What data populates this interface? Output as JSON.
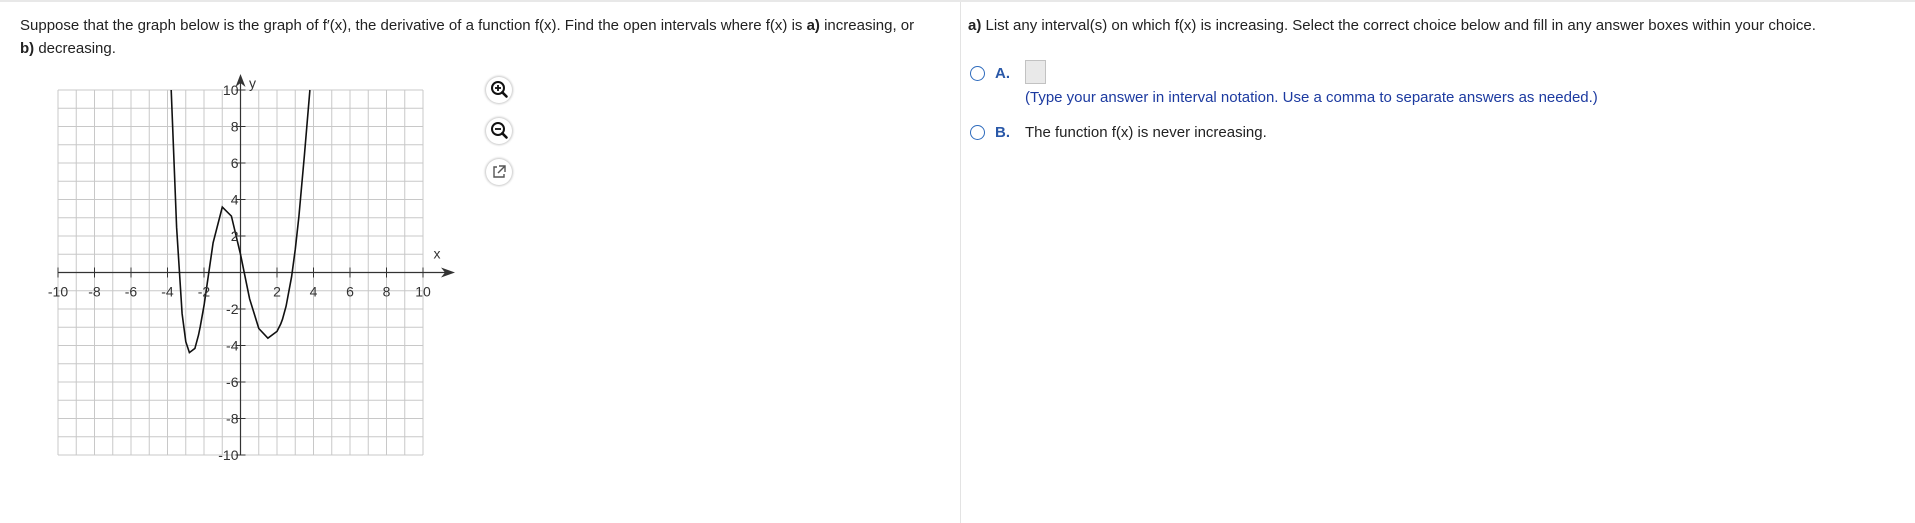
{
  "question": {
    "text_1": "Suppose that the graph below is the graph of ",
    "fprime": "f′(x)",
    "text_2": ", the derivative of a function f(x). Find the open intervals where f(x) is ",
    "a_label": "a)",
    "text_3": " increasing, or ",
    "b_label": "b)",
    "text_4": " decreasing."
  },
  "chart_data": {
    "type": "line",
    "title": "",
    "xlabel": "x",
    "ylabel": "y",
    "xlim": [
      -10,
      10
    ],
    "ylim": [
      -10,
      10
    ],
    "grid": true,
    "x_ticks": [
      "-10",
      "-8",
      "-6",
      "-4",
      "-2",
      "2",
      "4",
      "6",
      "8",
      "10"
    ],
    "y_ticks": [
      "10",
      "8",
      "6",
      "4",
      "2",
      "-2",
      "-4",
      "-6",
      "-8",
      "-10"
    ],
    "series": [
      {
        "x": [
          -3.8,
          -3.5,
          -3.2,
          -3.0,
          -2.8,
          -2.5,
          -2.3,
          -2.2,
          -2.0,
          -1.5,
          -1.0,
          -0.5,
          0.0,
          0.5,
          1.0,
          1.5,
          2.0,
          2.2,
          2.3,
          2.5,
          2.8,
          3.0,
          3.2,
          3.5,
          3.8
        ],
        "y": [
          10.0,
          2.48,
          -2.26,
          -3.79,
          -4.39,
          -4.16,
          -3.43,
          -2.95,
          -1.82,
          1.63,
          3.59,
          3.09,
          1.0,
          -1.44,
          -3.07,
          -3.6,
          -3.23,
          -2.82,
          -2.56,
          -1.84,
          -0.23,
          1.28,
          3.07,
          6.42,
          10.0
        ]
      }
    ]
  },
  "tools": {
    "zoom_in": "zoom-in-icon",
    "zoom_out": "zoom-out-icon",
    "popout": "external-link-icon"
  },
  "part_a": {
    "label": "a)",
    "prompt": " List any interval(s) on which f(x) is increasing. Select the correct choice below and fill in any answer boxes within your choice.",
    "choice_a_letter": "A.",
    "choice_a_hint": "(Type your answer in interval notation. Use a comma to separate answers as needed.)",
    "choice_b_letter": "B.",
    "choice_b_text": "The function f(x) is never increasing."
  },
  "colors": {
    "accent": "#2a58a8",
    "hint": "#1c3aa0",
    "grid": "#c8c8c8"
  }
}
